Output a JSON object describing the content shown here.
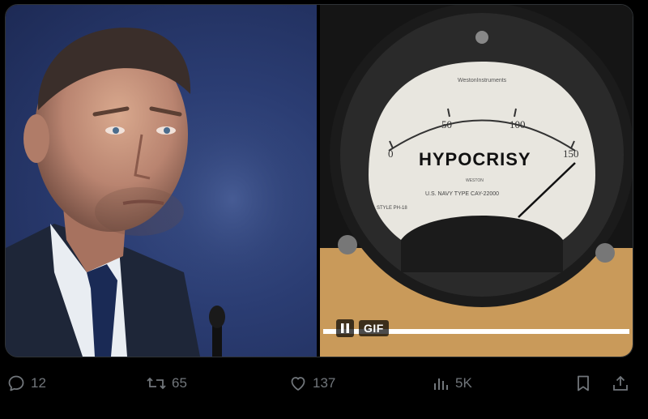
{
  "media": {
    "left_image_alt": "",
    "gauge": {
      "label": "HYPOCRISY",
      "scale_labels": [
        "0",
        "50",
        "100",
        "150"
      ],
      "maker": "WestonInstruments",
      "small_text_1": "WESTON",
      "small_text_2": "U.S. NAVY TYPE CAY-22000",
      "small_text_3": "STYLE PH-18"
    },
    "gif_badge": "GIF"
  },
  "actions": {
    "replies": "12",
    "reposts": "65",
    "likes": "137",
    "views": "5K"
  },
  "colors": {
    "background": "#000000",
    "muted": "#71767b",
    "border": "#2f3336"
  }
}
